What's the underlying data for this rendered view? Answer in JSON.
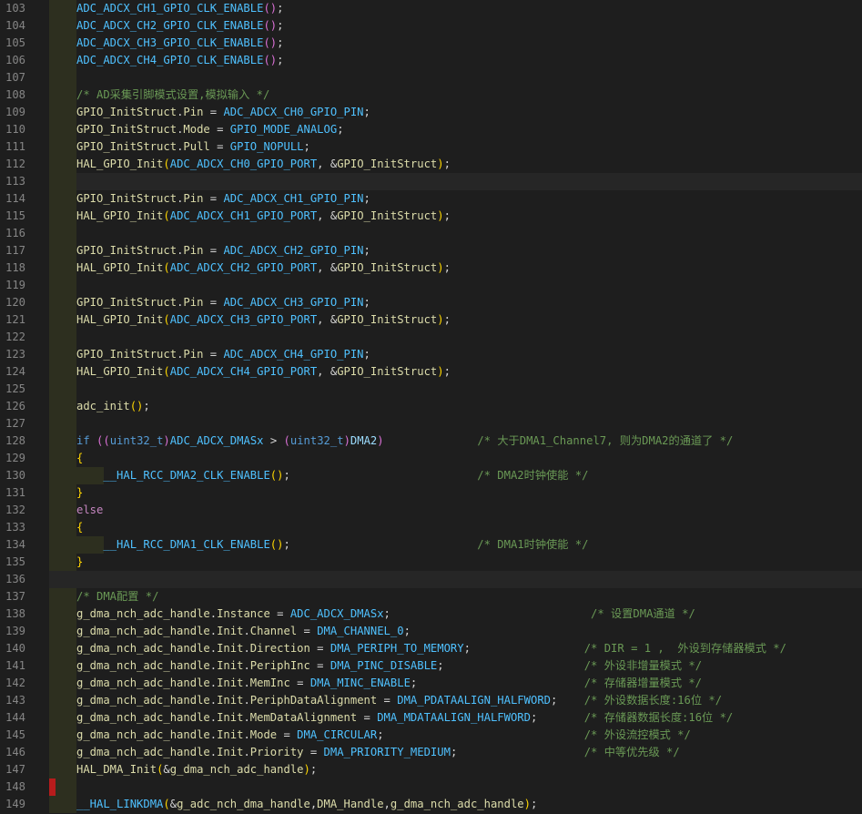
{
  "editor": {
    "lines": [
      {
        "n": "103",
        "ind": 1,
        "t": [
          [
            "ADC_ADCX_CH1_GPIO_CLK_ENABLE",
            "macro"
          ],
          [
            "()",
            "br1"
          ],
          [
            ";",
            "text"
          ]
        ]
      },
      {
        "n": "104",
        "ind": 1,
        "t": [
          [
            "ADC_ADCX_CH2_GPIO_CLK_ENABLE",
            "macro"
          ],
          [
            "()",
            "br1"
          ],
          [
            ";",
            "text"
          ]
        ]
      },
      {
        "n": "105",
        "ind": 1,
        "t": [
          [
            "ADC_ADCX_CH3_GPIO_CLK_ENABLE",
            "macro"
          ],
          [
            "()",
            "br1"
          ],
          [
            ";",
            "text"
          ]
        ]
      },
      {
        "n": "106",
        "ind": 1,
        "t": [
          [
            "ADC_ADCX_CH4_GPIO_CLK_ENABLE",
            "macro"
          ],
          [
            "()",
            "br1"
          ],
          [
            ";",
            "text"
          ]
        ]
      },
      {
        "n": "107",
        "ind": 1,
        "t": []
      },
      {
        "n": "108",
        "ind": 1,
        "t": [
          [
            "/* AD采集引脚模式设置,模拟输入 */",
            "com"
          ]
        ]
      },
      {
        "n": "109",
        "ind": 1,
        "t": [
          [
            "GPIO_InitStruct",
            "func"
          ],
          [
            ".",
            "text"
          ],
          [
            "Pin",
            "func"
          ],
          [
            " = ",
            "text"
          ],
          [
            "ADC_ADCX_CH0_GPIO_PIN",
            "macro"
          ],
          [
            ";",
            "text"
          ]
        ]
      },
      {
        "n": "110",
        "ind": 1,
        "t": [
          [
            "GPIO_InitStruct",
            "func"
          ],
          [
            ".",
            "text"
          ],
          [
            "Mode",
            "func"
          ],
          [
            " = ",
            "text"
          ],
          [
            "GPIO_MODE_ANALOG",
            "macro"
          ],
          [
            ";",
            "text"
          ]
        ]
      },
      {
        "n": "111",
        "ind": 1,
        "t": [
          [
            "GPIO_InitStruct",
            "func"
          ],
          [
            ".",
            "text"
          ],
          [
            "Pull",
            "func"
          ],
          [
            " = ",
            "text"
          ],
          [
            "GPIO_NOPULL",
            "macro"
          ],
          [
            ";",
            "text"
          ]
        ]
      },
      {
        "n": "112",
        "ind": 1,
        "t": [
          [
            "HAL_GPIO_Init",
            "func"
          ],
          [
            "(",
            "br2"
          ],
          [
            "ADC_ADCX_CH0_GPIO_PORT",
            "macro"
          ],
          [
            ", &",
            "text"
          ],
          [
            "GPIO_InitStruct",
            "func"
          ],
          [
            ")",
            "br2"
          ],
          [
            ";",
            "text"
          ]
        ]
      },
      {
        "n": "113",
        "ind": 1,
        "t": []
      },
      {
        "n": "114",
        "ind": 1,
        "t": [
          [
            "GPIO_InitStruct",
            "func"
          ],
          [
            ".",
            "text"
          ],
          [
            "Pin",
            "func"
          ],
          [
            " = ",
            "text"
          ],
          [
            "ADC_ADCX_CH1_GPIO_PIN",
            "macro"
          ],
          [
            ";",
            "text"
          ]
        ]
      },
      {
        "n": "115",
        "ind": 1,
        "t": [
          [
            "HAL_GPIO_Init",
            "func"
          ],
          [
            "(",
            "br2"
          ],
          [
            "ADC_ADCX_CH1_GPIO_PORT",
            "macro"
          ],
          [
            ", &",
            "text"
          ],
          [
            "GPIO_InitStruct",
            "func"
          ],
          [
            ")",
            "br2"
          ],
          [
            ";",
            "text"
          ]
        ]
      },
      {
        "n": "116",
        "ind": 1,
        "t": []
      },
      {
        "n": "117",
        "ind": 1,
        "t": [
          [
            "GPIO_InitStruct",
            "func"
          ],
          [
            ".",
            "text"
          ],
          [
            "Pin",
            "func"
          ],
          [
            " = ",
            "text"
          ],
          [
            "ADC_ADCX_CH2_GPIO_PIN",
            "macro"
          ],
          [
            ";",
            "text"
          ]
        ]
      },
      {
        "n": "118",
        "ind": 1,
        "t": [
          [
            "HAL_GPIO_Init",
            "func"
          ],
          [
            "(",
            "br2"
          ],
          [
            "ADC_ADCX_CH2_GPIO_PORT",
            "macro"
          ],
          [
            ", &",
            "text"
          ],
          [
            "GPIO_InitStruct",
            "func"
          ],
          [
            ")",
            "br2"
          ],
          [
            ";",
            "text"
          ]
        ]
      },
      {
        "n": "119",
        "ind": 1,
        "t": []
      },
      {
        "n": "120",
        "ind": 1,
        "t": [
          [
            "GPIO_InitStruct",
            "func"
          ],
          [
            ".",
            "text"
          ],
          [
            "Pin",
            "func"
          ],
          [
            " = ",
            "text"
          ],
          [
            "ADC_ADCX_CH3_GPIO_PIN",
            "macro"
          ],
          [
            ";",
            "text"
          ]
        ]
      },
      {
        "n": "121",
        "ind": 1,
        "t": [
          [
            "HAL_GPIO_Init",
            "func"
          ],
          [
            "(",
            "br2"
          ],
          [
            "ADC_ADCX_CH3_GPIO_PORT",
            "macro"
          ],
          [
            ", &",
            "text"
          ],
          [
            "GPIO_InitStruct",
            "func"
          ],
          [
            ")",
            "br2"
          ],
          [
            ";",
            "text"
          ]
        ]
      },
      {
        "n": "122",
        "ind": 1,
        "t": []
      },
      {
        "n": "123",
        "ind": 1,
        "t": [
          [
            "GPIO_InitStruct",
            "func"
          ],
          [
            ".",
            "text"
          ],
          [
            "Pin",
            "func"
          ],
          [
            " = ",
            "text"
          ],
          [
            "ADC_ADCX_CH4_GPIO_PIN",
            "macro"
          ],
          [
            ";",
            "text"
          ]
        ]
      },
      {
        "n": "124",
        "ind": 1,
        "t": [
          [
            "HAL_GPIO_Init",
            "func"
          ],
          [
            "(",
            "br2"
          ],
          [
            "ADC_ADCX_CH4_GPIO_PORT",
            "macro"
          ],
          [
            ", &",
            "text"
          ],
          [
            "GPIO_InitStruct",
            "func"
          ],
          [
            ")",
            "br2"
          ],
          [
            ";",
            "text"
          ]
        ]
      },
      {
        "n": "125",
        "ind": 1,
        "t": []
      },
      {
        "n": "126",
        "ind": 1,
        "t": [
          [
            "adc_init",
            "func"
          ],
          [
            "()",
            "br2"
          ],
          [
            ";",
            "text"
          ]
        ]
      },
      {
        "n": "127",
        "ind": 1,
        "t": []
      },
      {
        "n": "128",
        "ind": 1,
        "t": [
          [
            "if",
            "kw"
          ],
          [
            " ",
            "text"
          ],
          [
            "((",
            "br1"
          ],
          [
            "uint32_t",
            "kw"
          ],
          [
            ")",
            "br1"
          ],
          [
            "ADC_ADCX_DMASx",
            "macro"
          ],
          [
            " > ",
            "text"
          ],
          [
            "(",
            "br1"
          ],
          [
            "uint32_t",
            "kw"
          ],
          [
            ")",
            "br1"
          ],
          [
            "DMA2",
            "ident"
          ],
          [
            ")",
            "br1"
          ],
          [
            "              ",
            "text"
          ],
          [
            "/* 大于DMA1_Channel7, 则为DMA2的通道了 */",
            "com"
          ]
        ]
      },
      {
        "n": "129",
        "ind": 1,
        "t": [
          [
            "{",
            "br2"
          ]
        ]
      },
      {
        "n": "130",
        "ind": 2,
        "t": [
          [
            "    ",
            "text"
          ],
          [
            "__HAL_RCC_DMA2_CLK_ENABLE",
            "macro"
          ],
          [
            "()",
            "br2"
          ],
          [
            ";",
            "text"
          ],
          [
            "                            ",
            "text"
          ],
          [
            "/* DMA2时钟使能 */",
            "com"
          ]
        ]
      },
      {
        "n": "131",
        "ind": 1,
        "t": [
          [
            "}",
            "br2"
          ]
        ]
      },
      {
        "n": "132",
        "ind": 1,
        "t": [
          [
            "else",
            "kw2"
          ]
        ]
      },
      {
        "n": "133",
        "ind": 1,
        "t": [
          [
            "{",
            "br2"
          ]
        ]
      },
      {
        "n": "134",
        "ind": 2,
        "t": [
          [
            "    ",
            "text"
          ],
          [
            "__HAL_RCC_DMA1_CLK_ENABLE",
            "macro"
          ],
          [
            "()",
            "br2"
          ],
          [
            ";",
            "text"
          ],
          [
            "                            ",
            "text"
          ],
          [
            "/* DMA1时钟使能 */",
            "com"
          ]
        ]
      },
      {
        "n": "135",
        "ind": 1,
        "t": [
          [
            "}",
            "br2"
          ]
        ]
      },
      {
        "n": "136",
        "ind": 0,
        "t": []
      },
      {
        "n": "137",
        "ind": 1,
        "t": [
          [
            "/* DMA配置 */",
            "com"
          ]
        ]
      },
      {
        "n": "138",
        "ind": 1,
        "t": [
          [
            "g_dma_nch_adc_handle",
            "func"
          ],
          [
            ".",
            "text"
          ],
          [
            "Instance",
            "func"
          ],
          [
            " = ",
            "text"
          ],
          [
            "ADC_ADCX_DMASx",
            "macro"
          ],
          [
            ";",
            "text"
          ],
          [
            "                              ",
            "text"
          ],
          [
            "/* 设置DMA通道 */",
            "com"
          ]
        ]
      },
      {
        "n": "139",
        "ind": 1,
        "t": [
          [
            "g_dma_nch_adc_handle",
            "func"
          ],
          [
            ".",
            "text"
          ],
          [
            "Init",
            "func"
          ],
          [
            ".",
            "text"
          ],
          [
            "Channel",
            "func"
          ],
          [
            " = ",
            "text"
          ],
          [
            "DMA_CHANNEL_0",
            "macro"
          ],
          [
            ";",
            "text"
          ]
        ]
      },
      {
        "n": "140",
        "ind": 1,
        "t": [
          [
            "g_dma_nch_adc_handle",
            "func"
          ],
          [
            ".",
            "text"
          ],
          [
            "Init",
            "func"
          ],
          [
            ".",
            "text"
          ],
          [
            "Direction",
            "func"
          ],
          [
            " = ",
            "text"
          ],
          [
            "DMA_PERIPH_TO_MEMORY",
            "macro"
          ],
          [
            ";",
            "text"
          ],
          [
            "                 ",
            "text"
          ],
          [
            "/* DIR = 1 ,  外设到存储器模式 */",
            "com"
          ]
        ]
      },
      {
        "n": "141",
        "ind": 1,
        "t": [
          [
            "g_dma_nch_adc_handle",
            "func"
          ],
          [
            ".",
            "text"
          ],
          [
            "Init",
            "func"
          ],
          [
            ".",
            "text"
          ],
          [
            "PeriphInc",
            "func"
          ],
          [
            " = ",
            "text"
          ],
          [
            "DMA_PINC_DISABLE",
            "macro"
          ],
          [
            ";",
            "text"
          ],
          [
            "                     ",
            "text"
          ],
          [
            "/* 外设非增量模式 */",
            "com"
          ]
        ]
      },
      {
        "n": "142",
        "ind": 1,
        "t": [
          [
            "g_dma_nch_adc_handle",
            "func"
          ],
          [
            ".",
            "text"
          ],
          [
            "Init",
            "func"
          ],
          [
            ".",
            "text"
          ],
          [
            "MemInc",
            "func"
          ],
          [
            " = ",
            "text"
          ],
          [
            "DMA_MINC_ENABLE",
            "macro"
          ],
          [
            ";",
            "text"
          ],
          [
            "                         ",
            "text"
          ],
          [
            "/* 存储器增量模式 */",
            "com"
          ]
        ]
      },
      {
        "n": "143",
        "ind": 1,
        "t": [
          [
            "g_dma_nch_adc_handle",
            "func"
          ],
          [
            ".",
            "text"
          ],
          [
            "Init",
            "func"
          ],
          [
            ".",
            "text"
          ],
          [
            "PeriphDataAlignment",
            "func"
          ],
          [
            " = ",
            "text"
          ],
          [
            "DMA_PDATAALIGN_HALFWORD",
            "macro"
          ],
          [
            ";",
            "text"
          ],
          [
            "    ",
            "text"
          ],
          [
            "/* 外设数据长度:16位 */",
            "com"
          ]
        ]
      },
      {
        "n": "144",
        "ind": 1,
        "t": [
          [
            "g_dma_nch_adc_handle",
            "func"
          ],
          [
            ".",
            "text"
          ],
          [
            "Init",
            "func"
          ],
          [
            ".",
            "text"
          ],
          [
            "MemDataAlignment",
            "func"
          ],
          [
            " = ",
            "text"
          ],
          [
            "DMA_MDATAALIGN_HALFWORD",
            "macro"
          ],
          [
            ";",
            "text"
          ],
          [
            "       ",
            "text"
          ],
          [
            "/* 存储器数据长度:16位 */",
            "com"
          ]
        ]
      },
      {
        "n": "145",
        "ind": 1,
        "t": [
          [
            "g_dma_nch_adc_handle",
            "func"
          ],
          [
            ".",
            "text"
          ],
          [
            "Init",
            "func"
          ],
          [
            ".",
            "text"
          ],
          [
            "Mode",
            "func"
          ],
          [
            " = ",
            "text"
          ],
          [
            "DMA_CIRCULAR",
            "macro"
          ],
          [
            ";",
            "text"
          ],
          [
            "                              ",
            "text"
          ],
          [
            "/* 外设流控模式 */",
            "com"
          ]
        ]
      },
      {
        "n": "146",
        "ind": 1,
        "t": [
          [
            "g_dma_nch_adc_handle",
            "func"
          ],
          [
            ".",
            "text"
          ],
          [
            "Init",
            "func"
          ],
          [
            ".",
            "text"
          ],
          [
            "Priority",
            "func"
          ],
          [
            " = ",
            "text"
          ],
          [
            "DMA_PRIORITY_MEDIUM",
            "macro"
          ],
          [
            ";",
            "text"
          ],
          [
            "                   ",
            "text"
          ],
          [
            "/* 中等优先级 */",
            "com"
          ]
        ]
      },
      {
        "n": "147",
        "ind": 1,
        "t": [
          [
            "HAL_DMA_Init",
            "func"
          ],
          [
            "(",
            "br2"
          ],
          [
            "&",
            "text"
          ],
          [
            "g_dma_nch_adc_handle",
            "func"
          ],
          [
            ")",
            "br2"
          ],
          [
            ";",
            "text"
          ]
        ]
      },
      {
        "n": "148",
        "ind": 1,
        "err": true,
        "t": []
      },
      {
        "n": "149",
        "ind": 1,
        "t": [
          [
            "__HAL_LINKDMA",
            "macro"
          ],
          [
            "(",
            "br2"
          ],
          [
            "&",
            "text"
          ],
          [
            "g_adc_nch_dma_handle",
            "func"
          ],
          [
            ",",
            "text"
          ],
          [
            "DMA_Handle",
            "func"
          ],
          [
            ",",
            "text"
          ],
          [
            "g_dma_nch_adc_handle",
            "func"
          ],
          [
            ")",
            "br2"
          ],
          [
            ";",
            "text"
          ]
        ]
      }
    ]
  },
  "colors": {
    "background": "#1e1e1e",
    "line_number": "#858585",
    "indent_guide": "#2d2f1f",
    "error_mark": "#b71c1c"
  }
}
